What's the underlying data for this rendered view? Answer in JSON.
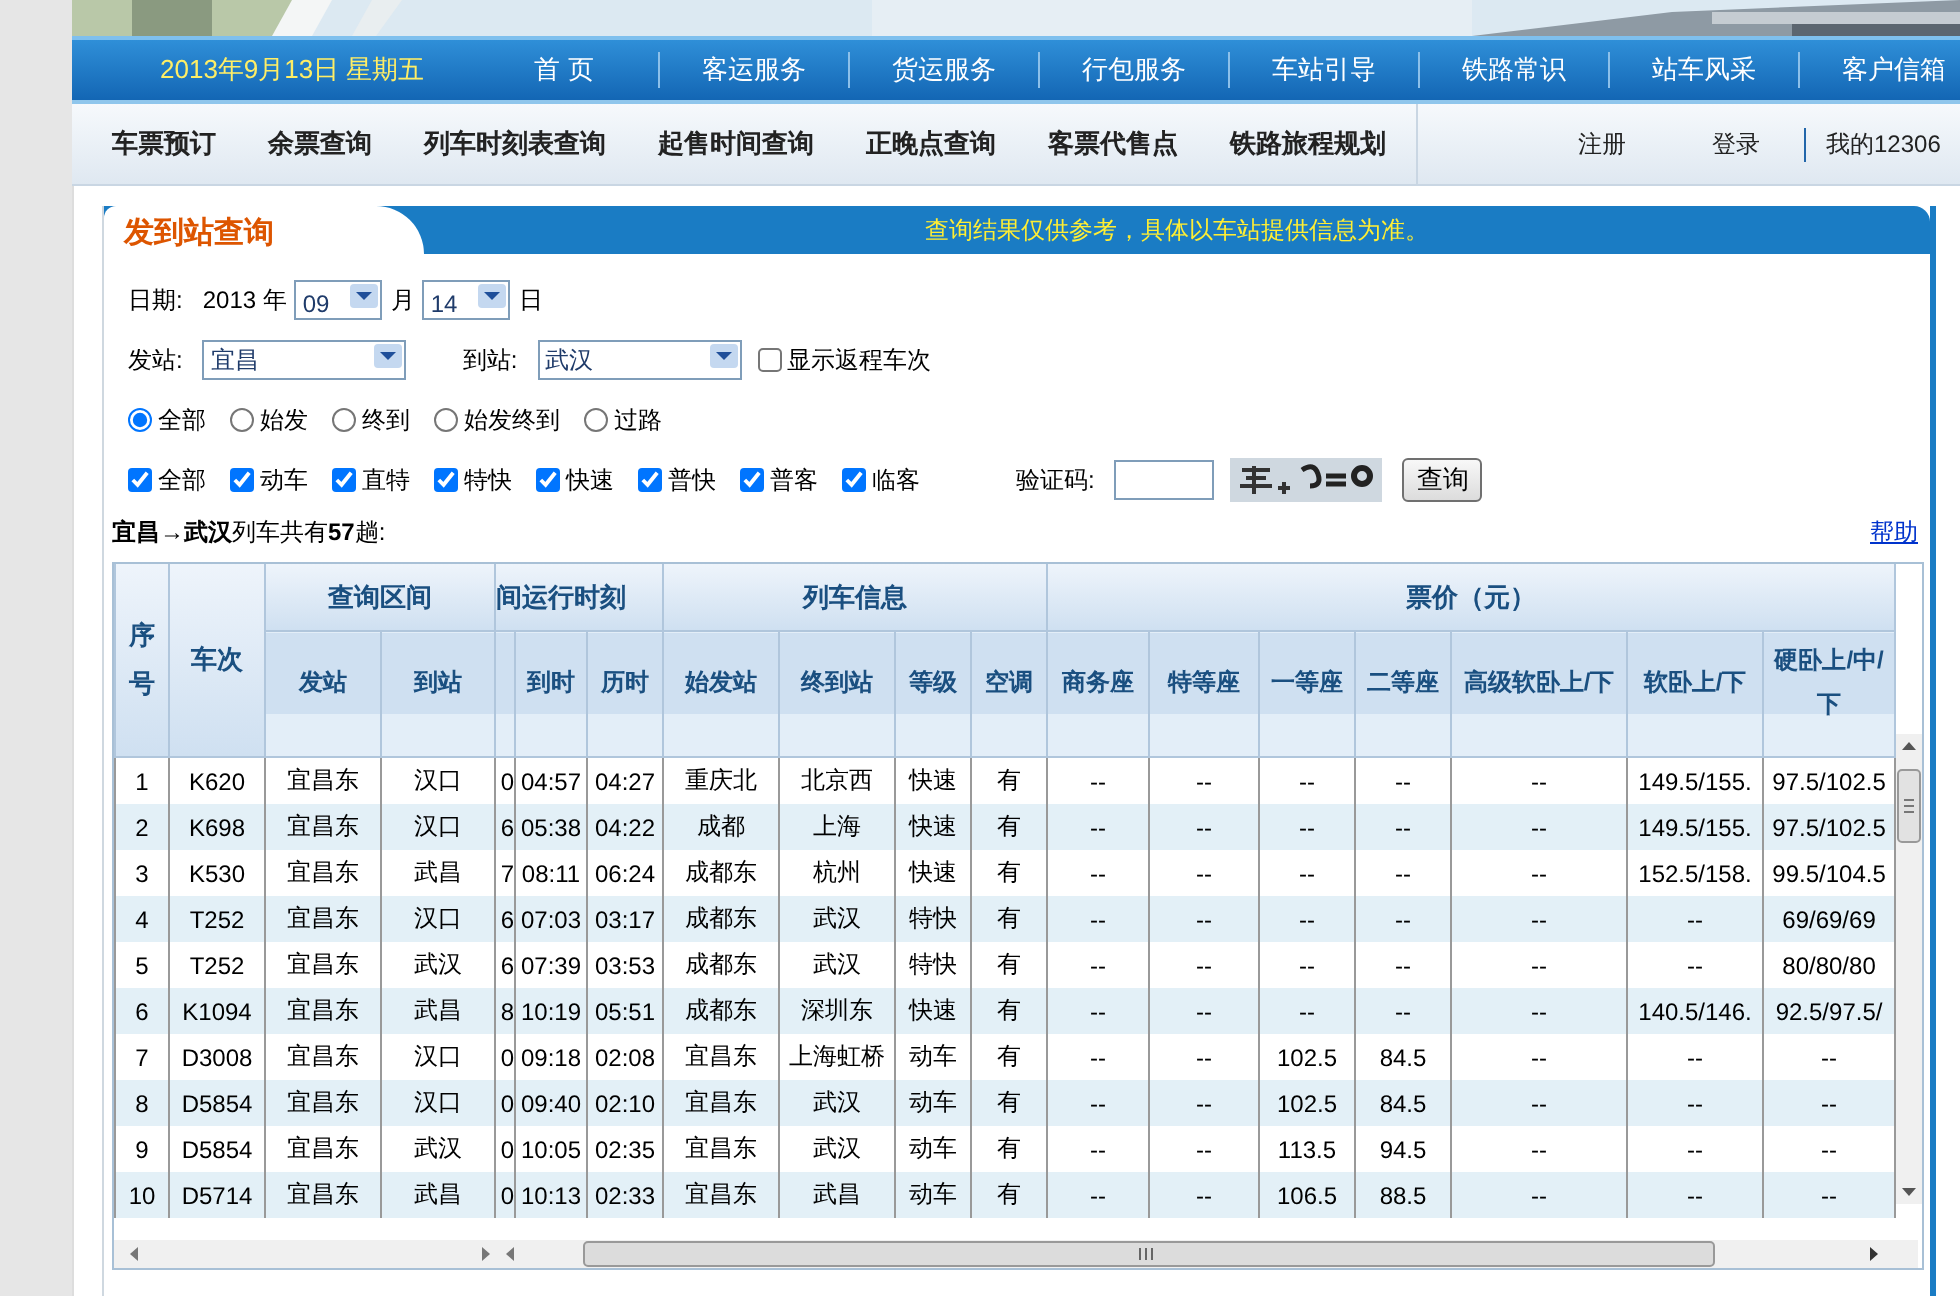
{
  "header": {
    "date": "2013年9月13日 星期五",
    "main_nav": [
      "首 页",
      "客运服务",
      "货运服务",
      "行包服务",
      "车站引导",
      "铁路常识",
      "站车风采",
      "客户信箱"
    ],
    "sub_nav": [
      "车票预订",
      "余票查询",
      "列车时刻表查询",
      "起售时间查询",
      "正晚点查询",
      "客票代售点",
      "铁路旅程规划"
    ],
    "account_links": [
      "注册",
      "登录",
      "我的12306"
    ]
  },
  "panel": {
    "tab": "发到站查询",
    "notice": "查询结果仅供参考，具体以车站提供信息为准。"
  },
  "form": {
    "date_label": "日期:",
    "year": "2013 年",
    "month": "09",
    "month_unit": "月",
    "day": "14",
    "day_unit": "日",
    "from_label": "发站:",
    "from": "宜昌",
    "to_label": "到站:",
    "to": "武汉",
    "return_trains": {
      "label": "显示返程车次",
      "checked": false
    },
    "stop_types": [
      {
        "label": "全部",
        "selected": true
      },
      {
        "label": "始发",
        "selected": false
      },
      {
        "label": "终到",
        "selected": false
      },
      {
        "label": "始发终到",
        "selected": false
      },
      {
        "label": "过路",
        "selected": false
      }
    ],
    "train_types": [
      {
        "label": "全部",
        "checked": true
      },
      {
        "label": "动车",
        "checked": true
      },
      {
        "label": "直特",
        "checked": true
      },
      {
        "label": "特快",
        "checked": true
      },
      {
        "label": "快速",
        "checked": true
      },
      {
        "label": "普快",
        "checked": true
      },
      {
        "label": "普客",
        "checked": true
      },
      {
        "label": "临客",
        "checked": true
      }
    ],
    "captcha_label": "验证码:",
    "search_button": "查询"
  },
  "summary": "**宜昌→武汉**列车共有**57**趟:",
  "help_link": "帮助",
  "table": {
    "header": [
      {
        "label": "序号"
      },
      {
        "label": "车次"
      },
      {
        "label": "查询区间",
        "columns": [
          "发站",
          "到站"
        ]
      },
      {
        "label": "间运行时刻",
        "clipped": true,
        "columns": [
          "到时",
          "历时"
        ]
      },
      {
        "label": "列车信息",
        "columns": [
          "始发站",
          "终到站",
          "等级",
          "空调"
        ]
      },
      {
        "label": "票价（元）",
        "columns": [
          "商务座",
          "特等座",
          "一等座",
          "二等座",
          "高级软卧上/下",
          "软卧上/下",
          "硬卧上/中/下"
        ]
      }
    ],
    "rows": [
      [
        "1",
        "K620",
        "宜昌东",
        "汉口",
        "0",
        "04:57",
        "04:27",
        "重庆北",
        "北京西",
        "快速",
        "有",
        "--",
        "--",
        "--",
        "--",
        "--",
        "149.5/155.",
        "97.5/102.5"
      ],
      [
        "2",
        "K698",
        "宜昌东",
        "汉口",
        "6",
        "05:38",
        "04:22",
        "成都",
        "上海",
        "快速",
        "有",
        "--",
        "--",
        "--",
        "--",
        "--",
        "149.5/155.",
        "97.5/102.5"
      ],
      [
        "3",
        "K530",
        "宜昌东",
        "武昌",
        "7",
        "08:11",
        "06:24",
        "成都东",
        "杭州",
        "快速",
        "有",
        "--",
        "--",
        "--",
        "--",
        "--",
        "152.5/158.",
        "99.5/104.5"
      ],
      [
        "4",
        "T252",
        "宜昌东",
        "汉口",
        "6",
        "07:03",
        "03:17",
        "成都东",
        "武汉",
        "特快",
        "有",
        "--",
        "--",
        "--",
        "--",
        "--",
        "--",
        "69/69/69"
      ],
      [
        "5",
        "T252",
        "宜昌东",
        "武汉",
        "6",
        "07:39",
        "03:53",
        "成都东",
        "武汉",
        "特快",
        "有",
        "--",
        "--",
        "--",
        "--",
        "--",
        "--",
        "80/80/80"
      ],
      [
        "6",
        "K1094",
        "宜昌东",
        "武昌",
        "8",
        "10:19",
        "05:51",
        "成都东",
        "深圳东",
        "快速",
        "有",
        "--",
        "--",
        "--",
        "--",
        "--",
        "140.5/146.",
        "92.5/97.5/"
      ],
      [
        "7",
        "D3008",
        "宜昌东",
        "汉口",
        "0",
        "09:18",
        "02:08",
        "宜昌东",
        "上海虹桥",
        "动车",
        "有",
        "--",
        "--",
        "102.5",
        "84.5",
        "--",
        "--",
        "--"
      ],
      [
        "8",
        "D5854",
        "宜昌东",
        "汉口",
        "0",
        "09:40",
        "02:10",
        "宜昌东",
        "武汉",
        "动车",
        "有",
        "--",
        "--",
        "102.5",
        "84.5",
        "--",
        "--",
        "--"
      ],
      [
        "9",
        "D5854",
        "宜昌东",
        "武汉",
        "0",
        "10:05",
        "02:35",
        "宜昌东",
        "武汉",
        "动车",
        "有",
        "--",
        "--",
        "113.5",
        "94.5",
        "--",
        "--",
        "--"
      ],
      [
        "10",
        "D5714",
        "宜昌东",
        "武昌",
        "0",
        "10:13",
        "02:33",
        "宜昌东",
        "武昌",
        "动车",
        "有",
        "--",
        "--",
        "106.5",
        "88.5",
        "--",
        "--",
        "--"
      ]
    ]
  }
}
